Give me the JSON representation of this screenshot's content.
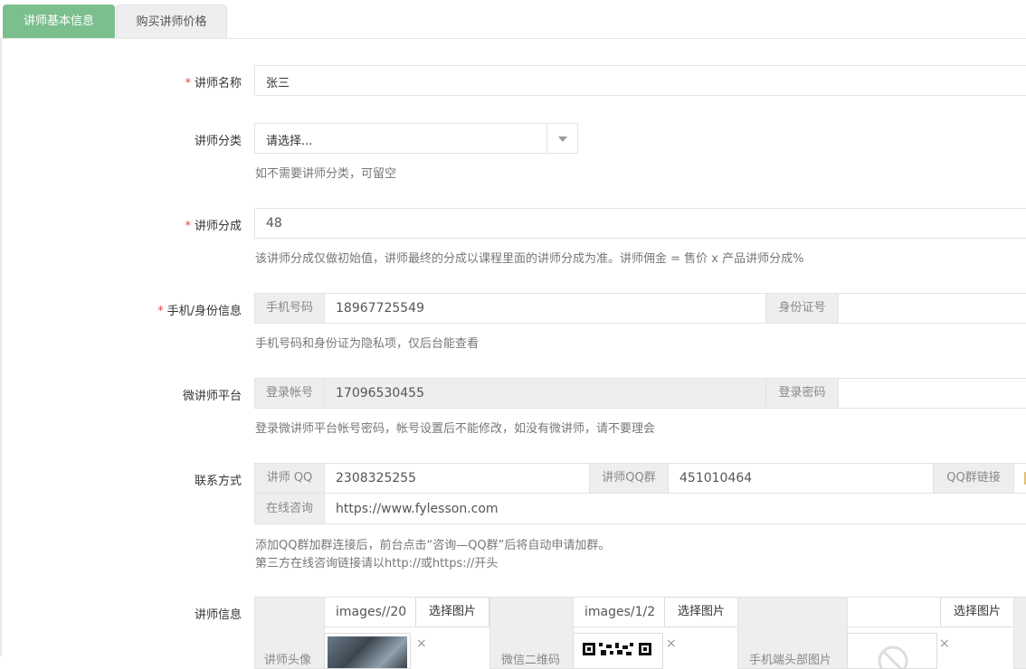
{
  "tabs": {
    "basic": "讲师基本信息",
    "price": "购买讲师价格"
  },
  "name": {
    "label": "讲师名称",
    "value": "张三"
  },
  "category": {
    "label": "讲师分类",
    "selected": "请选择...",
    "help": "如不需要讲师分类，可留空"
  },
  "commission": {
    "label": "讲师分成",
    "value": "48",
    "help": "该讲师分成仅做初始值，讲师最终的分成以课程里面的讲师分成为准。讲师佣金 = 售价 x 产品讲师分成%"
  },
  "identity": {
    "label": "手机/身份信息",
    "phone_addon": "手机号码",
    "phone_value": "18967725549",
    "id_addon": "身份证号",
    "id_value": "",
    "help": "手机号码和身份证为隐私项，仅后台能查看"
  },
  "platform": {
    "label": "微讲师平台",
    "account_addon": "登录帐号",
    "account_value": "17096530455",
    "password_addon": "登录密码",
    "password_value": "",
    "help": "登录微讲师平台帐号密码，帐号设置后不能修改，如没有微讲师，请不要理会"
  },
  "contact": {
    "label": "联系方式",
    "qq_addon": "讲师 QQ",
    "qq_value": "2308325255",
    "group_addon": "讲师QQ群",
    "group_value": "451010464",
    "group_link_addon": "QQ群链接",
    "consult_addon": "在线咨询",
    "consult_value": "https://www.fylesson.com",
    "help_line1": "添加QQ群加群连接后，前台点击“咨询—QQ群”后将自动申请加群。",
    "help_line2": "第三方在线咨询链接请以http://或https://开头"
  },
  "info": {
    "label": "讲师信息",
    "avatar_path": "images//20",
    "qrcode_path": "images/1/2",
    "mobile_path": "",
    "choose_btn": "选择图片",
    "remove_symbol": "×",
    "avatar_label": "讲师头像",
    "qrcode_label": "微信二维码",
    "mobile_label": "手机端头部图片"
  },
  "colors": {
    "active_tab": "#7cbf8f",
    "required": "#e2484b",
    "addon_bg": "#eeeeee"
  }
}
